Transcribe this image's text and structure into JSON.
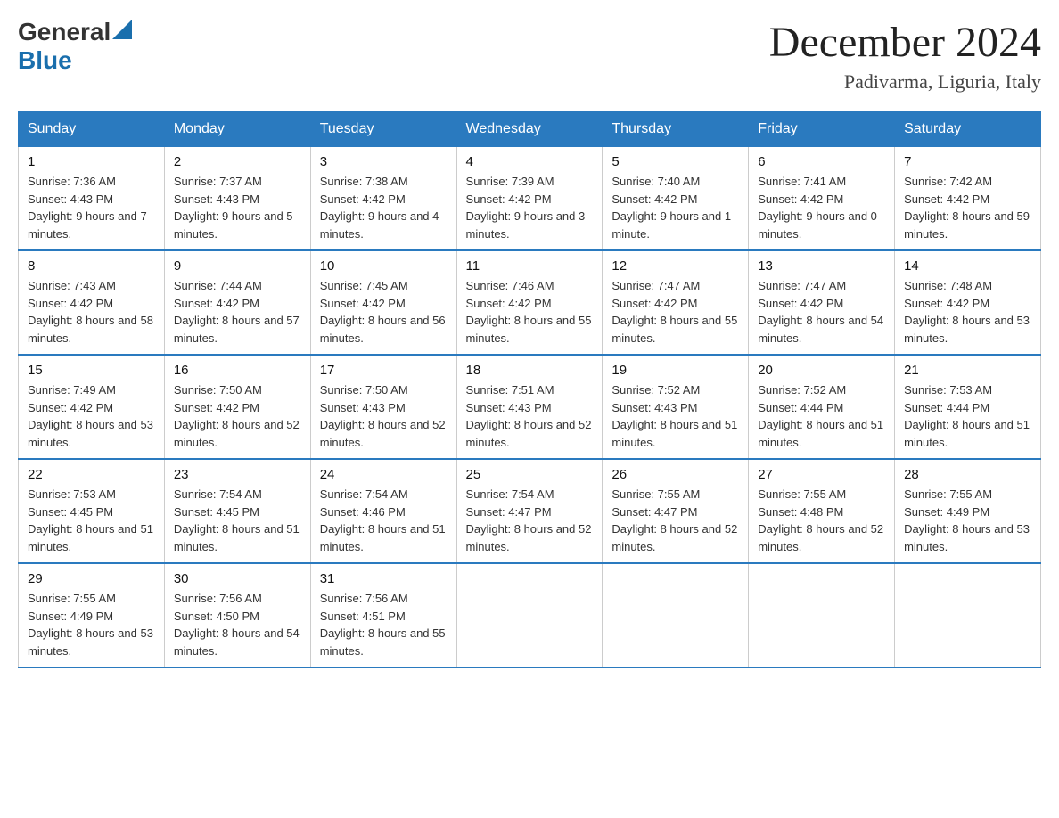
{
  "header": {
    "logo_general": "General",
    "logo_blue": "Blue",
    "month": "December 2024",
    "location": "Padivarma, Liguria, Italy"
  },
  "weekdays": [
    "Sunday",
    "Monday",
    "Tuesday",
    "Wednesday",
    "Thursday",
    "Friday",
    "Saturday"
  ],
  "weeks": [
    [
      {
        "day": "1",
        "sunrise": "7:36 AM",
        "sunset": "4:43 PM",
        "daylight": "9 hours and 7 minutes."
      },
      {
        "day": "2",
        "sunrise": "7:37 AM",
        "sunset": "4:43 PM",
        "daylight": "9 hours and 5 minutes."
      },
      {
        "day": "3",
        "sunrise": "7:38 AM",
        "sunset": "4:42 PM",
        "daylight": "9 hours and 4 minutes."
      },
      {
        "day": "4",
        "sunrise": "7:39 AM",
        "sunset": "4:42 PM",
        "daylight": "9 hours and 3 minutes."
      },
      {
        "day": "5",
        "sunrise": "7:40 AM",
        "sunset": "4:42 PM",
        "daylight": "9 hours and 1 minute."
      },
      {
        "day": "6",
        "sunrise": "7:41 AM",
        "sunset": "4:42 PM",
        "daylight": "9 hours and 0 minutes."
      },
      {
        "day": "7",
        "sunrise": "7:42 AM",
        "sunset": "4:42 PM",
        "daylight": "8 hours and 59 minutes."
      }
    ],
    [
      {
        "day": "8",
        "sunrise": "7:43 AM",
        "sunset": "4:42 PM",
        "daylight": "8 hours and 58 minutes."
      },
      {
        "day": "9",
        "sunrise": "7:44 AM",
        "sunset": "4:42 PM",
        "daylight": "8 hours and 57 minutes."
      },
      {
        "day": "10",
        "sunrise": "7:45 AM",
        "sunset": "4:42 PM",
        "daylight": "8 hours and 56 minutes."
      },
      {
        "day": "11",
        "sunrise": "7:46 AM",
        "sunset": "4:42 PM",
        "daylight": "8 hours and 55 minutes."
      },
      {
        "day": "12",
        "sunrise": "7:47 AM",
        "sunset": "4:42 PM",
        "daylight": "8 hours and 55 minutes."
      },
      {
        "day": "13",
        "sunrise": "7:47 AM",
        "sunset": "4:42 PM",
        "daylight": "8 hours and 54 minutes."
      },
      {
        "day": "14",
        "sunrise": "7:48 AM",
        "sunset": "4:42 PM",
        "daylight": "8 hours and 53 minutes."
      }
    ],
    [
      {
        "day": "15",
        "sunrise": "7:49 AM",
        "sunset": "4:42 PM",
        "daylight": "8 hours and 53 minutes."
      },
      {
        "day": "16",
        "sunrise": "7:50 AM",
        "sunset": "4:42 PM",
        "daylight": "8 hours and 52 minutes."
      },
      {
        "day": "17",
        "sunrise": "7:50 AM",
        "sunset": "4:43 PM",
        "daylight": "8 hours and 52 minutes."
      },
      {
        "day": "18",
        "sunrise": "7:51 AM",
        "sunset": "4:43 PM",
        "daylight": "8 hours and 52 minutes."
      },
      {
        "day": "19",
        "sunrise": "7:52 AM",
        "sunset": "4:43 PM",
        "daylight": "8 hours and 51 minutes."
      },
      {
        "day": "20",
        "sunrise": "7:52 AM",
        "sunset": "4:44 PM",
        "daylight": "8 hours and 51 minutes."
      },
      {
        "day": "21",
        "sunrise": "7:53 AM",
        "sunset": "4:44 PM",
        "daylight": "8 hours and 51 minutes."
      }
    ],
    [
      {
        "day": "22",
        "sunrise": "7:53 AM",
        "sunset": "4:45 PM",
        "daylight": "8 hours and 51 minutes."
      },
      {
        "day": "23",
        "sunrise": "7:54 AM",
        "sunset": "4:45 PM",
        "daylight": "8 hours and 51 minutes."
      },
      {
        "day": "24",
        "sunrise": "7:54 AM",
        "sunset": "4:46 PM",
        "daylight": "8 hours and 51 minutes."
      },
      {
        "day": "25",
        "sunrise": "7:54 AM",
        "sunset": "4:47 PM",
        "daylight": "8 hours and 52 minutes."
      },
      {
        "day": "26",
        "sunrise": "7:55 AM",
        "sunset": "4:47 PM",
        "daylight": "8 hours and 52 minutes."
      },
      {
        "day": "27",
        "sunrise": "7:55 AM",
        "sunset": "4:48 PM",
        "daylight": "8 hours and 52 minutes."
      },
      {
        "day": "28",
        "sunrise": "7:55 AM",
        "sunset": "4:49 PM",
        "daylight": "8 hours and 53 minutes."
      }
    ],
    [
      {
        "day": "29",
        "sunrise": "7:55 AM",
        "sunset": "4:49 PM",
        "daylight": "8 hours and 53 minutes."
      },
      {
        "day": "30",
        "sunrise": "7:56 AM",
        "sunset": "4:50 PM",
        "daylight": "8 hours and 54 minutes."
      },
      {
        "day": "31",
        "sunrise": "7:56 AM",
        "sunset": "4:51 PM",
        "daylight": "8 hours and 55 minutes."
      },
      null,
      null,
      null,
      null
    ]
  ]
}
